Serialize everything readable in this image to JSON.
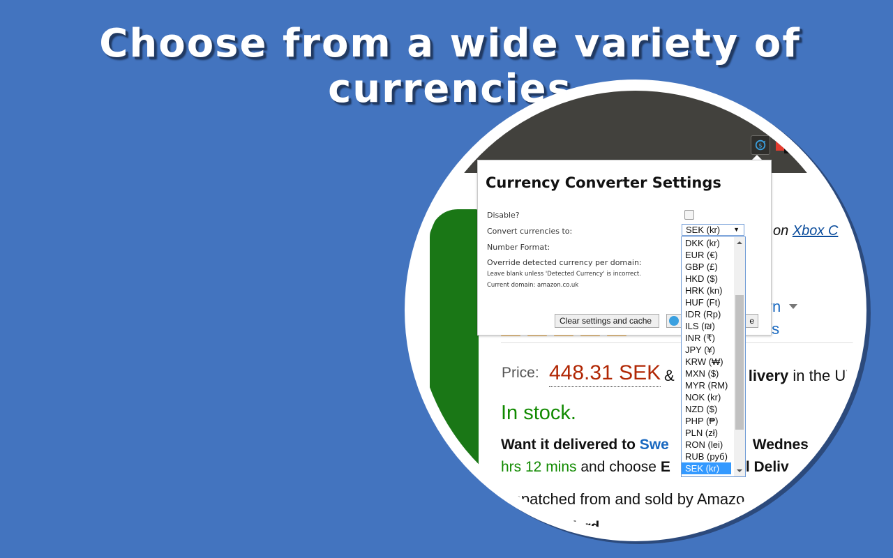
{
  "headline": "Choose from a wide variety of currencies",
  "colors": {
    "background": "#4374bf",
    "toolbar": "#42413d",
    "price": "#b12704",
    "in_stock": "#118a00",
    "link_blue": "#1868c0",
    "selected_option": "#3399ff"
  },
  "browser": {
    "extension_icon": "currency-converter-icon",
    "other_extension_icon": "red-extension-icon"
  },
  "popup": {
    "title": "Currency Converter Settings",
    "disable_label": "Disable?",
    "disable_checked": false,
    "convert_label": "Convert currencies to:",
    "number_format_label": "Number Format:",
    "override_label": "Override detected currency per domain:",
    "override_hint": "Leave blank unless 'Detected Currency' is incorrect.",
    "current_domain": "Current domain: amazon.co.uk",
    "selected_currency": "SEK (kr)",
    "clear_button": "Clear settings and cache",
    "save_button_tail": "e",
    "currency_options": [
      "DKK (kr)",
      "EUR (€)",
      "GBP (£)",
      "HKD ($)",
      "HRK (kn)",
      "HUF (Ft)",
      "IDR (Rp)",
      "ILS (₪)",
      "INR (₹)",
      "JPY (¥)",
      "KRW (₩)",
      "MXN ($)",
      "MYR (RM)",
      "NOK (kr)",
      "NZD ($)",
      "PHP (₱)",
      "PLN (zł)",
      "RON (lei)",
      "RUB (руб)",
      "SEK (kr)"
    ],
    "selected_index": 19
  },
  "product_page": {
    "on_text": "on ",
    "platform_link": "Xbox C",
    "brand_partial": "yn",
    "reviews_partial": "ews",
    "price_label": "Price:",
    "price_value": "448.31 SEK",
    "price_rest_prefix": "& ",
    "price_rest_bold": "livery",
    "price_rest_suffix": " in the U'",
    "in_stock": "In stock.",
    "want_prefix": "Want it delivered to ",
    "want_country": "Swe",
    "want_suffix": "      Wednes",
    "hrs_green": "hrs 12 mins",
    "hrs_mid": " and choose ",
    "hrs_bold": "E            l Deliv",
    "dispatched": "ispatched from and sold by Amazo",
    "standard": "ndard"
  }
}
